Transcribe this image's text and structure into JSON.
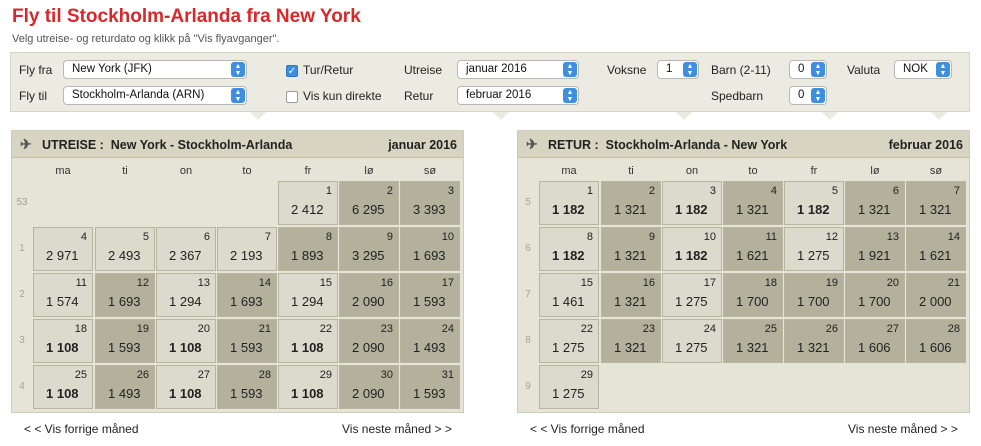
{
  "page": {
    "title": "Fly til Stockholm-Arlanda fra New York",
    "subtitle": "Velg utreise- og returdato og klikk på \"Vis flyavganger\"."
  },
  "search": {
    "from_label": "Fly fra",
    "from_value": "New York (JFK)",
    "to_label": "Fly til",
    "to_value": "Stockholm-Arlanda (ARN)",
    "round_trip_label": "Tur/Retur",
    "round_trip_checked": true,
    "direct_only_label": "Vis kun direkte",
    "direct_only_checked": false,
    "depart_label": "Utreise",
    "depart_value": "januar 2016",
    "return_label": "Retur",
    "return_value": "februar 2016",
    "adults_label": "Voksne",
    "adults_value": "1",
    "children_label": "Barn (2-11)",
    "children_value": "0",
    "infants_label": "Spedbarn",
    "infants_value": "0",
    "currency_label": "Valuta",
    "currency_value": "NOK"
  },
  "outbound": {
    "label": "UTREISE :",
    "route": "New York - Stockholm-Arlanda",
    "month": "januar 2016",
    "weekdays": [
      "ma",
      "ti",
      "on",
      "to",
      "fr",
      "lø",
      "sø"
    ],
    "weeks": [
      {
        "week": "53",
        "days": [
          null,
          null,
          null,
          null,
          {
            "day": "1",
            "price": "2 412",
            "shade": "light"
          },
          {
            "day": "2",
            "price": "6 295",
            "shade": "dark"
          },
          {
            "day": "3",
            "price": "3 393",
            "shade": "dark"
          }
        ]
      },
      {
        "week": "1",
        "days": [
          {
            "day": "4",
            "price": "2 971",
            "shade": "light"
          },
          {
            "day": "5",
            "price": "2 493",
            "shade": "light"
          },
          {
            "day": "6",
            "price": "2 367",
            "shade": "light"
          },
          {
            "day": "7",
            "price": "2 193",
            "shade": "light"
          },
          {
            "day": "8",
            "price": "1 893",
            "shade": "dark"
          },
          {
            "day": "9",
            "price": "3 295",
            "shade": "dark"
          },
          {
            "day": "10",
            "price": "1 693",
            "shade": "dark"
          }
        ]
      },
      {
        "week": "2",
        "days": [
          {
            "day": "11",
            "price": "1 574",
            "shade": "light"
          },
          {
            "day": "12",
            "price": "1 693",
            "shade": "dark"
          },
          {
            "day": "13",
            "price": "1 294",
            "shade": "light"
          },
          {
            "day": "14",
            "price": "1 693",
            "shade": "dark"
          },
          {
            "day": "15",
            "price": "1 294",
            "shade": "light"
          },
          {
            "day": "16",
            "price": "2 090",
            "shade": "dark"
          },
          {
            "day": "17",
            "price": "1 593",
            "shade": "dark"
          }
        ]
      },
      {
        "week": "3",
        "days": [
          {
            "day": "18",
            "price": "1 108",
            "shade": "light",
            "best": true
          },
          {
            "day": "19",
            "price": "1 593",
            "shade": "dark"
          },
          {
            "day": "20",
            "price": "1 108",
            "shade": "light",
            "best": true
          },
          {
            "day": "21",
            "price": "1 593",
            "shade": "dark"
          },
          {
            "day": "22",
            "price": "1 108",
            "shade": "light",
            "best": true
          },
          {
            "day": "23",
            "price": "2 090",
            "shade": "dark"
          },
          {
            "day": "24",
            "price": "1 493",
            "shade": "dark"
          }
        ]
      },
      {
        "week": "4",
        "days": [
          {
            "day": "25",
            "price": "1 108",
            "shade": "light",
            "best": true
          },
          {
            "day": "26",
            "price": "1 493",
            "shade": "dark"
          },
          {
            "day": "27",
            "price": "1 108",
            "shade": "light",
            "best": true
          },
          {
            "day": "28",
            "price": "1 593",
            "shade": "dark"
          },
          {
            "day": "29",
            "price": "1 108",
            "shade": "light",
            "best": true
          },
          {
            "day": "30",
            "price": "2 090",
            "shade": "dark"
          },
          {
            "day": "31",
            "price": "1 593",
            "shade": "dark"
          }
        ]
      }
    ],
    "prev_label": "< < Vis forrige måned",
    "next_label": "Vis neste måned > >"
  },
  "return": {
    "label": "RETUR :",
    "route": "Stockholm-Arlanda - New York",
    "month": "februar 2016",
    "weekdays": [
      "ma",
      "ti",
      "on",
      "to",
      "fr",
      "lø",
      "sø"
    ],
    "weeks": [
      {
        "week": "5",
        "days": [
          {
            "day": "1",
            "price": "1 182",
            "shade": "light",
            "best": true
          },
          {
            "day": "2",
            "price": "1 321",
            "shade": "dark"
          },
          {
            "day": "3",
            "price": "1 182",
            "shade": "light",
            "best": true
          },
          {
            "day": "4",
            "price": "1 321",
            "shade": "dark"
          },
          {
            "day": "5",
            "price": "1 182",
            "shade": "light",
            "best": true
          },
          {
            "day": "6",
            "price": "1 321",
            "shade": "dark"
          },
          {
            "day": "7",
            "price": "1 321",
            "shade": "dark"
          }
        ]
      },
      {
        "week": "6",
        "days": [
          {
            "day": "8",
            "price": "1 182",
            "shade": "light",
            "best": true
          },
          {
            "day": "9",
            "price": "1 321",
            "shade": "dark"
          },
          {
            "day": "10",
            "price": "1 182",
            "shade": "light",
            "best": true
          },
          {
            "day": "11",
            "price": "1 621",
            "shade": "dark"
          },
          {
            "day": "12",
            "price": "1 275",
            "shade": "light"
          },
          {
            "day": "13",
            "price": "1 921",
            "shade": "dark"
          },
          {
            "day": "14",
            "price": "1 621",
            "shade": "dark"
          }
        ]
      },
      {
        "week": "7",
        "days": [
          {
            "day": "15",
            "price": "1 461",
            "shade": "light"
          },
          {
            "day": "16",
            "price": "1 321",
            "shade": "dark"
          },
          {
            "day": "17",
            "price": "1 275",
            "shade": "light"
          },
          {
            "day": "18",
            "price": "1 700",
            "shade": "dark"
          },
          {
            "day": "19",
            "price": "1 700",
            "shade": "dark"
          },
          {
            "day": "20",
            "price": "1 700",
            "shade": "dark"
          },
          {
            "day": "21",
            "price": "2 000",
            "shade": "dark"
          }
        ]
      },
      {
        "week": "8",
        "days": [
          {
            "day": "22",
            "price": "1 275",
            "shade": "light"
          },
          {
            "day": "23",
            "price": "1 321",
            "shade": "dark"
          },
          {
            "day": "24",
            "price": "1 275",
            "shade": "light"
          },
          {
            "day": "25",
            "price": "1 321",
            "shade": "dark"
          },
          {
            "day": "26",
            "price": "1 321",
            "shade": "dark"
          },
          {
            "day": "27",
            "price": "1 606",
            "shade": "dark"
          },
          {
            "day": "28",
            "price": "1 606",
            "shade": "dark"
          }
        ]
      },
      {
        "week": "9",
        "days": [
          {
            "day": "29",
            "price": "1 275",
            "shade": "light"
          },
          null,
          null,
          null,
          null,
          null,
          null
        ]
      }
    ],
    "prev_label": "< < Vis forrige måned",
    "next_label": "Vis neste måned > >"
  }
}
